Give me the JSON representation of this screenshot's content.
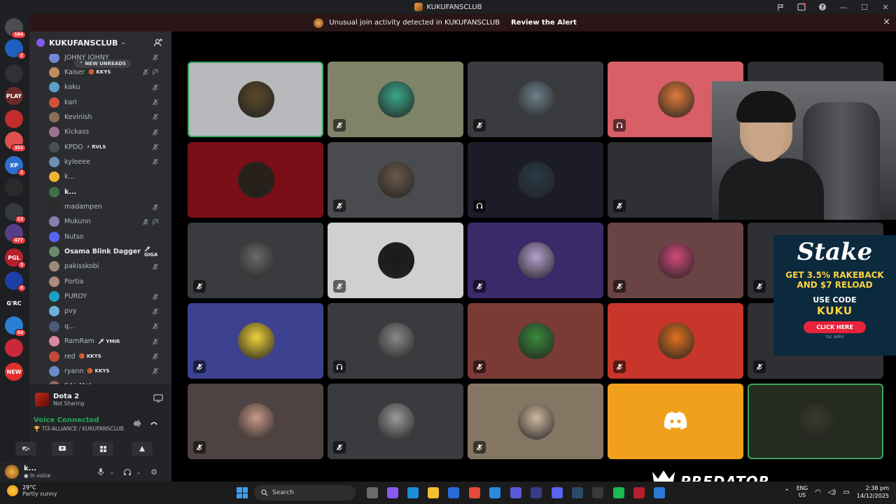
{
  "window": {
    "title": "KUKUFANSCLUB"
  },
  "alert": {
    "text": "Unusual join activity detected in KUKUFANSCLUB",
    "action_label": "Review the Alert",
    "close_glyph": "×"
  },
  "server_rail": [
    {
      "badge": "184",
      "color": "#4a4d52",
      "label": ""
    },
    {
      "badge": "2",
      "color": "#1f5fbf",
      "label": ""
    },
    {
      "badge": "",
      "color": "#2f3136",
      "label": ""
    },
    {
      "badge": "",
      "color": "#6b2a2a",
      "label": "PLAY"
    },
    {
      "badge": "",
      "color": "#c22d2d",
      "label": ""
    },
    {
      "badge": "352",
      "color": "#e04f4f",
      "label": ""
    },
    {
      "badge": "1",
      "color": "#2c6fd1",
      "label": "XP"
    },
    {
      "badge": "",
      "color": "#2a2a2a",
      "label": ""
    },
    {
      "badge": "13",
      "color": "#36393f",
      "label": ""
    },
    {
      "badge": "477",
      "color": "#5a3d8a",
      "label": ""
    },
    {
      "badge": "3",
      "color": "#b81f2d",
      "label": "PGL"
    },
    {
      "badge": "4",
      "color": "#1f3fa8",
      "label": ""
    },
    {
      "badge": "",
      "color": "#1e1f22",
      "label": "G'RC"
    },
    {
      "badge": "59",
      "color": "#2b7fd6",
      "label": ""
    },
    {
      "badge": "",
      "color": "#c9293a",
      "label": ""
    },
    {
      "badge": "",
      "color": "#e02e2e",
      "label": "NEW"
    }
  ],
  "server": {
    "name": "KUKUFANSCLUB",
    "new_unreads": "NEW UNREADS"
  },
  "members": [
    {
      "name": "JOHNY JOHNY",
      "tag": "",
      "bold": false,
      "color": "#7289da",
      "muted": true,
      "deaf": false
    },
    {
      "name": "Kaiser",
      "tag": "🏀 KKYS",
      "bold": false,
      "color": "#c48b5c",
      "muted": true,
      "deaf": true
    },
    {
      "name": "kaku",
      "tag": "",
      "bold": false,
      "color": "#5aa0c8",
      "muted": true,
      "deaf": false
    },
    {
      "name": "karl",
      "tag": "",
      "bold": false,
      "color": "#d0533b",
      "muted": true,
      "deaf": false
    },
    {
      "name": "Kevinish",
      "tag": "",
      "bold": false,
      "color": "#8a6e5a",
      "muted": true,
      "deaf": false
    },
    {
      "name": "Kickass",
      "tag": "",
      "bold": false,
      "color": "#a07090",
      "muted": true,
      "deaf": false
    },
    {
      "name": "KPDO",
      "tag": "⚡ RVLS",
      "bold": false,
      "color": "#4b4f57",
      "muted": true,
      "deaf": false
    },
    {
      "name": "kyleeee",
      "tag": "",
      "bold": false,
      "color": "#6e8fb3",
      "muted": true,
      "deaf": false
    },
    {
      "name": "k...",
      "tag": "",
      "bold": false,
      "color": "#f0b232",
      "muted": false,
      "deaf": false
    },
    {
      "name": "k...",
      "tag": "",
      "bold": true,
      "color": "#3f6f45",
      "muted": false,
      "deaf": false
    },
    {
      "name": "madampen",
      "tag": "",
      "bold": false,
      "color": "#2a2a2a",
      "muted": true,
      "deaf": false
    },
    {
      "name": "Mukunn",
      "tag": "",
      "bold": false,
      "color": "#8a7fb0",
      "muted": true,
      "deaf": true
    },
    {
      "name": "Nutso",
      "tag": "",
      "bold": false,
      "color": "#5865f2",
      "muted": false,
      "deaf": false
    },
    {
      "name": "Osama Blink Dagger",
      "tag": "🗡 GIGA",
      "bold": true,
      "color": "#6a8a6a",
      "muted": false,
      "deaf": false
    },
    {
      "name": "pakisskobi",
      "tag": "",
      "bold": false,
      "color": "#9a8a7a",
      "muted": true,
      "deaf": false
    },
    {
      "name": "Portia",
      "tag": "",
      "bold": false,
      "color": "#b08a7a",
      "muted": false,
      "deaf": false
    },
    {
      "name": "PUROY",
      "tag": "",
      "bold": false,
      "color": "#1aa1c7",
      "muted": true,
      "deaf": false
    },
    {
      "name": "pvy",
      "tag": "",
      "bold": false,
      "color": "#6ab0d8",
      "muted": true,
      "deaf": false
    },
    {
      "name": "q...",
      "tag": "",
      "bold": false,
      "color": "#4a5a7a",
      "muted": true,
      "deaf": false
    },
    {
      "name": "RamRam",
      "tag": "🗡 YMIR",
      "bold": false,
      "color": "#d88aa0",
      "muted": true,
      "deaf": false
    },
    {
      "name": "red",
      "tag": "🏀 KKYS",
      "bold": false,
      "color": "#c24a3a",
      "muted": true,
      "deaf": false
    },
    {
      "name": "ryann",
      "tag": "🏀 KKYS",
      "bold": false,
      "color": "#6a8ac8",
      "muted": true,
      "deaf": false
    },
    {
      "name": "SAL Mat",
      "tag": "",
      "bold": false,
      "color": "#8a6a5a",
      "muted": false,
      "deaf": false
    }
  ],
  "activity": {
    "title": "Dota 2",
    "subtitle": "Not Sharing"
  },
  "voice": {
    "status": "Voice Connected",
    "channel": "🏆 TI3-ALLIANCE / KUKUFANSCLUB"
  },
  "self": {
    "name": "k...",
    "status": "In voice"
  },
  "tiles": [
    {
      "bg": "#b8b9bd",
      "avatar": "#5a4a2a",
      "speaking": true,
      "mic": "none"
    },
    {
      "bg": "#7f8368",
      "avatar": "#3aa88a",
      "speaking": false,
      "mic": "muted"
    },
    {
      "bg": "#3a3b3f",
      "avatar": "#6e7f8a",
      "speaking": false,
      "mic": "muted"
    },
    {
      "bg": "#d85e68",
      "avatar": "#e07a3a",
      "speaking": false,
      "mic": "deaf"
    },
    {
      "bg": "#2e3035",
      "avatar": "",
      "speaking": false,
      "mic": "none"
    },
    {
      "bg": "#7a0e16",
      "avatar": "#2a2015",
      "speaking": false,
      "mic": "none"
    },
    {
      "bg": "#4a4b4e",
      "avatar": "#6a5a4a",
      "speaking": false,
      "mic": "muted"
    },
    {
      "bg": "#1b1c28",
      "avatar": "#2a3a4a",
      "speaking": false,
      "mic": "deaf"
    },
    {
      "bg": "#2e3035",
      "avatar": "",
      "speaking": false,
      "mic": "muted"
    },
    {
      "bg": "#2e3035",
      "avatar": "",
      "speaking": false,
      "mic": "none"
    },
    {
      "bg": "#3a3b3f",
      "avatar": "#6a6a6a",
      "speaking": false,
      "mic": "muted"
    },
    {
      "bg": "#cfd0d2",
      "avatar": "#1a1a1a",
      "speaking": false,
      "mic": "muted"
    },
    {
      "bg": "#3a2a6a",
      "avatar": "#b8a0d0",
      "speaking": false,
      "mic": "muted"
    },
    {
      "bg": "#6a4444",
      "avatar": "#d04a7a",
      "speaking": false,
      "mic": "muted"
    },
    {
      "bg": "#2e3035",
      "avatar": "",
      "speaking": false,
      "mic": "muted"
    },
    {
      "bg": "#3c4290",
      "avatar": "#f0d23a",
      "speaking": false,
      "mic": "muted"
    },
    {
      "bg": "#3a3b3f",
      "avatar": "#8a8a8a",
      "speaking": false,
      "mic": "deaf"
    },
    {
      "bg": "#7a3a36",
      "avatar": "#3a8a3a",
      "speaking": false,
      "mic": "muted"
    },
    {
      "bg": "#c8352a",
      "avatar": "#e07020",
      "speaking": false,
      "mic": "muted"
    },
    {
      "bg": "#2e3035",
      "avatar": "",
      "speaking": false,
      "mic": "muted"
    },
    {
      "bg": "#4f4242",
      "avatar": "#c89a8a",
      "speaking": false,
      "mic": "muted"
    },
    {
      "bg": "#3a3b3f",
      "avatar": "#9a9a9a",
      "speaking": false,
      "mic": "muted"
    },
    {
      "bg": "#857664",
      "avatar": "#d0b8a0",
      "speaking": false,
      "mic": "muted"
    },
    {
      "bg": "#f0a01c",
      "avatar": "discord",
      "speaking": false,
      "mic": "none"
    },
    {
      "bg": "#252b1e",
      "avatar": "#3a3a2a",
      "speaking": true,
      "mic": "none"
    }
  ],
  "ad": {
    "logo": "Stake",
    "line1": "GET 3.5% RAKEBACK",
    "line2": "AND $7 RELOAD",
    "line3": "USE CODE",
    "code": "KUKU",
    "button": "CLICK HERE",
    "tc": "T&C APPLY"
  },
  "taskbar": {
    "temp": "29°C",
    "condition": "Partly sunny",
    "search_placeholder": "Search",
    "lang_top": "ENG",
    "lang_bottom": "US",
    "time": "2:38 pm",
    "date": "14/12/2025"
  },
  "overlay": {
    "brand": "PREDATOR"
  },
  "colors": {
    "accent_green": "#23a55a",
    "alert_bg": "#2a1616",
    "sidebar_bg": "#2b2d31",
    "rail_bg": "#1e1f22"
  }
}
